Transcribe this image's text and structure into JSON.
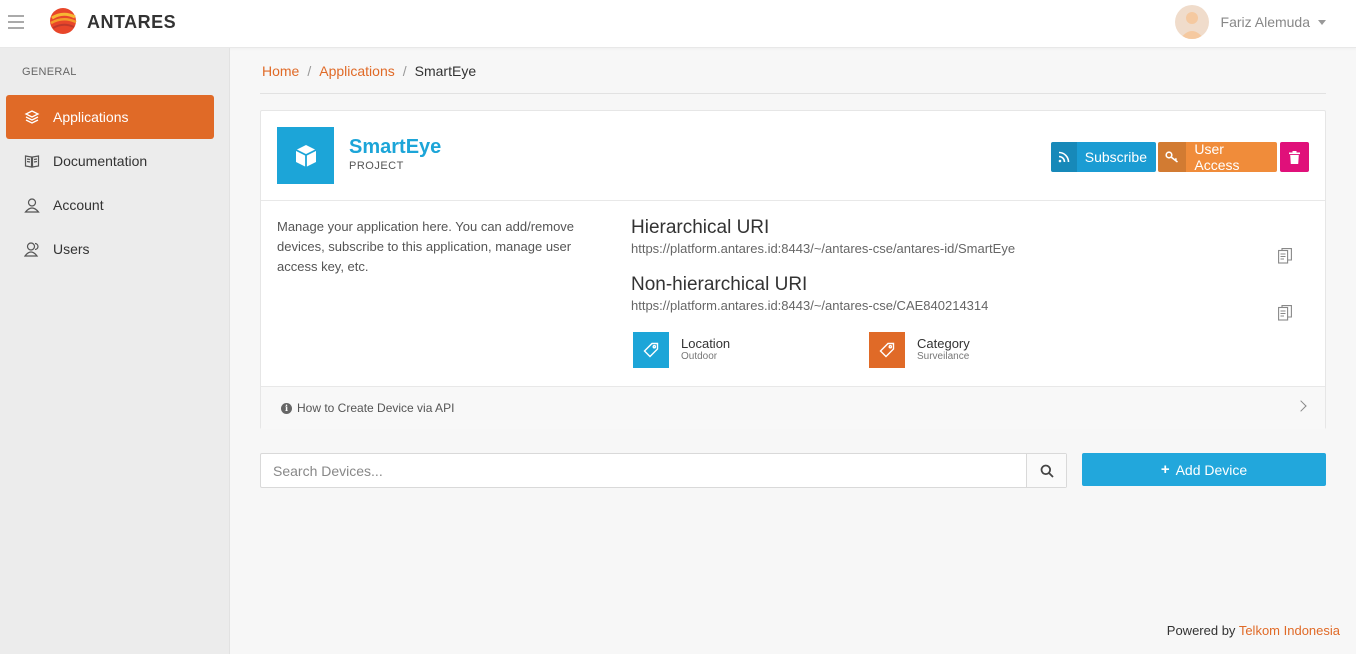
{
  "brand": {
    "name": "ANTARES"
  },
  "user": {
    "name": "Fariz Alemuda"
  },
  "sidebar": {
    "section": "GENERAL",
    "items": [
      {
        "label": "Applications",
        "icon": "layers-icon",
        "active": true
      },
      {
        "label": "Documentation",
        "icon": "book-icon"
      },
      {
        "label": "Account",
        "icon": "user-icon"
      },
      {
        "label": "Users",
        "icon": "users-icon"
      }
    ]
  },
  "breadcrumb": {
    "home": "Home",
    "applications": "Applications",
    "current": "SmartEye",
    "separator": "/"
  },
  "project": {
    "name": "SmartEye",
    "type": "PROJECT",
    "description": "Manage your application here. You can add/remove devices, subscribe to this application, manage user access key, etc.",
    "hierarchical_title": "Hierarchical URI",
    "hierarchical_uri": "https://platform.antares.id:8443/~/antares-cse/antares-id/SmartEye",
    "nonhierarchical_title": "Non-hierarchical URI",
    "nonhierarchical_uri": "https://platform.antares.id:8443/~/antares-cse/CAE840214314",
    "location_label": "Location",
    "location_value": "Outdoor",
    "category_label": "Category",
    "category_value": "Surveilance",
    "help_link": "How to Create Device via API"
  },
  "buttons": {
    "subscribe": "Subscribe",
    "user_access": "User Access",
    "add_device": "Add Device"
  },
  "search": {
    "placeholder": "Search Devices..."
  },
  "footer": {
    "prefix": "Powered by",
    "link": "Telkom Indonesia"
  },
  "colors": {
    "accent": "#e06a27",
    "primary": "#1ca5d8",
    "danger": "#e0107a",
    "warning": "#f08c3a"
  }
}
